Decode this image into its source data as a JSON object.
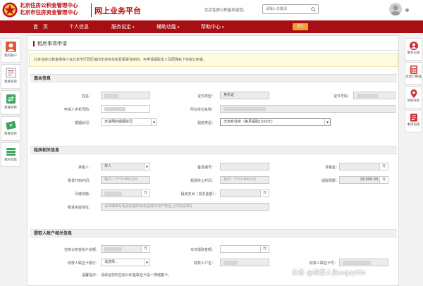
{
  "header": {
    "logo_line1": "北京住房公积金管理中心",
    "logo_line2": "北京市住房资金管理中心",
    "platform_title": "网上业务平台",
    "welcome": "北京住房公积金欢迎您。",
    "search_placeholder": "请输入关键词"
  },
  "nav": {
    "items": [
      {
        "label": "首　页",
        "caret": ""
      },
      {
        "label": "个人信息",
        "caret": ""
      },
      {
        "label": "服务设定",
        "caret": "▾"
      },
      {
        "label": "辅助功能",
        "caret": "▾"
      },
      {
        "label": "帮助中心",
        "caret": "▾"
      }
    ],
    "badge": "退出"
  },
  "left_sidebar": [
    {
      "label": "我的账户",
      "icon": "account-icon"
    },
    {
      "label": "我要提取",
      "icon": "withdraw-icon"
    },
    {
      "label": "我要转移",
      "icon": "transfer-icon"
    },
    {
      "label": "我要还款",
      "icon": "repay-icon"
    },
    {
      "label": "我的贷款",
      "icon": "loan-icon"
    }
  ],
  "right_sidebar": [
    {
      "label": "服务记录",
      "icon": "service-record-icon"
    },
    {
      "label": "贷款计算器",
      "icon": "calculator-icon"
    },
    {
      "label": "地图导航",
      "icon": "map-icon"
    },
    {
      "label": "事项指南",
      "icon": "guide-icon"
    }
  ],
  "page": {
    "title": "租房事项申请",
    "notice": "北京住房公积金缴存人在北京市行政区域内无自有住房且租赁住房的，可申请提取本人及配偶名下住房公积金。"
  },
  "basic": {
    "title": "基本信息",
    "name_label": "姓名：",
    "id_type_label": "证件类型：",
    "id_type_value": "身份证",
    "id_no_label": "证件号码：",
    "phone_label": "申请人手机号码：",
    "employer_label": "所在单位名称：",
    "marital_label": "婚姻状况：",
    "marital_value": "未说明的婚姻状况",
    "rent_type_label": "租房类型：",
    "rent_type_value": "无自有住房（每月提取1500元）"
  },
  "rent": {
    "title": "租房相关信息",
    "holder_label": "承租人：",
    "holder_value": "本人",
    "record_label": "备案编号：",
    "monthly_rent_label": "月租金：",
    "unit": "元",
    "start_label": "租赁开始时间：",
    "end_label": "租赁终止时间：",
    "date_placeholder": "格式：YYYY-MM-DD",
    "limit_label": "提取限额：",
    "limit_value": "18,000.00",
    "monthly_pay_label": "月缴存额：",
    "total_label": "租房支出（发票金额）：",
    "address_label": "租赁房屋地址：",
    "address_placeholder": "请详细填写租赁房屋所有权证或不动产权证上的地址填写"
  },
  "receiver": {
    "title": "提取人账户相关信息",
    "balance_label": "住房公积金账户余额：",
    "amount_label": "本次提取金额：",
    "bank_label": "收款人联名卡银行：",
    "bank_value": "请选择...",
    "acct_name_label": "收款人户名：",
    "acct_no_label": "收款人联名卡号：",
    "hint_label": "温馨提示：",
    "hint": "请保证您的住房公积金联名卡是一类储蓄卡。"
  },
  "watermark": "头条 @说享人生enjoylife"
}
